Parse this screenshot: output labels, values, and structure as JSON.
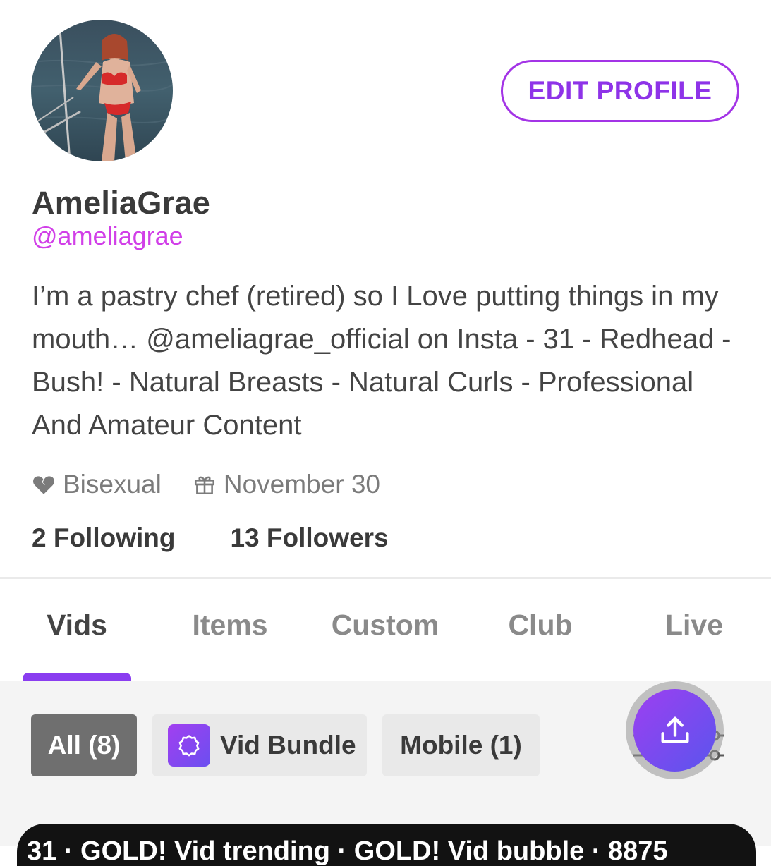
{
  "profile": {
    "display_name": "AmeliaGrae",
    "handle": "@ameliagrae",
    "bio": "I’m a pastry chef (retired) so I Love putting things in my mouth… @ameliagrae_official on Insta - 31 - Redhead - Bush! - Natural Breasts - Natural Curls - Professional And Amateur Content",
    "edit_button": "EDIT PROFILE",
    "orientation": "Bisexual",
    "birthday": "November 30",
    "following_count": "2",
    "following_label": "Following",
    "followers_count": "13",
    "followers_label": "Followers"
  },
  "tabs": [
    {
      "label": "Vids",
      "active": true
    },
    {
      "label": "Items",
      "active": false
    },
    {
      "label": "Custom",
      "active": false
    },
    {
      "label": "Club",
      "active": false
    },
    {
      "label": "Live",
      "active": false
    }
  ],
  "filters": {
    "all": "All (8)",
    "bundle": "Vid Bundle",
    "mobile": "Mobile (1)"
  },
  "card_peek_text": "31 · GOLD! Vid trending · GOLD! Vid bubble · 8875",
  "colors": {
    "accent": "#8e33e8",
    "handle": "#d13fe8",
    "tab_indicator": "#8a3df0",
    "chip_active_bg": "#6f6f6f"
  },
  "icons": {
    "orientation": "broken-heart-icon",
    "birthday": "gift-icon",
    "bundle": "bundle-badge-icon",
    "upload": "upload-icon",
    "filter": "sliders-icon"
  }
}
